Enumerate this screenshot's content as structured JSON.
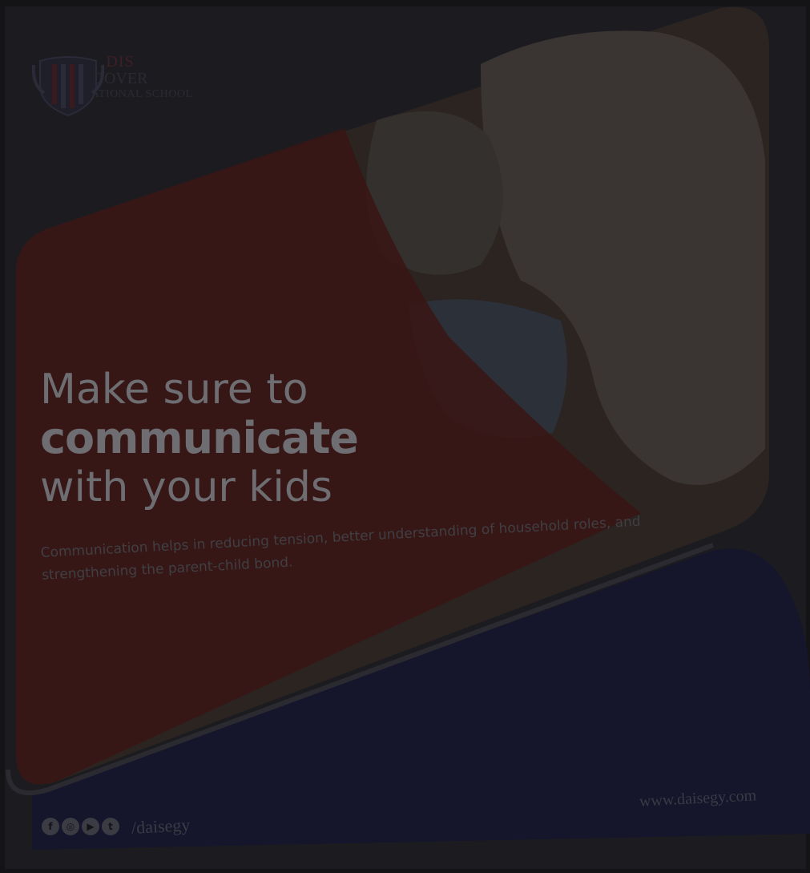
{
  "logo": {
    "initials": "DIS",
    "name": "DOVER",
    "subtitle": "INTERNATIONAL SCHOOL"
  },
  "headline": {
    "line1": "Make sure to",
    "line2": "communicate",
    "line3": "with your kids"
  },
  "body": "Communication helps in reducing tension, better understanding of household roles, and strengthening the parent-child bond.",
  "footer": {
    "social_icons": [
      "facebook-icon",
      "instagram-icon",
      "youtube-icon",
      "twitter-icon"
    ],
    "handle": "/daisegy",
    "website": "www.daisegy.com"
  },
  "colors": {
    "overlay_bg": "#141417",
    "card": "#1e1e22",
    "photo_dark": "#2a2320",
    "red_panel": "#3a1414",
    "navy_panel": "#14142e",
    "headline_text": "#6e6e72"
  }
}
